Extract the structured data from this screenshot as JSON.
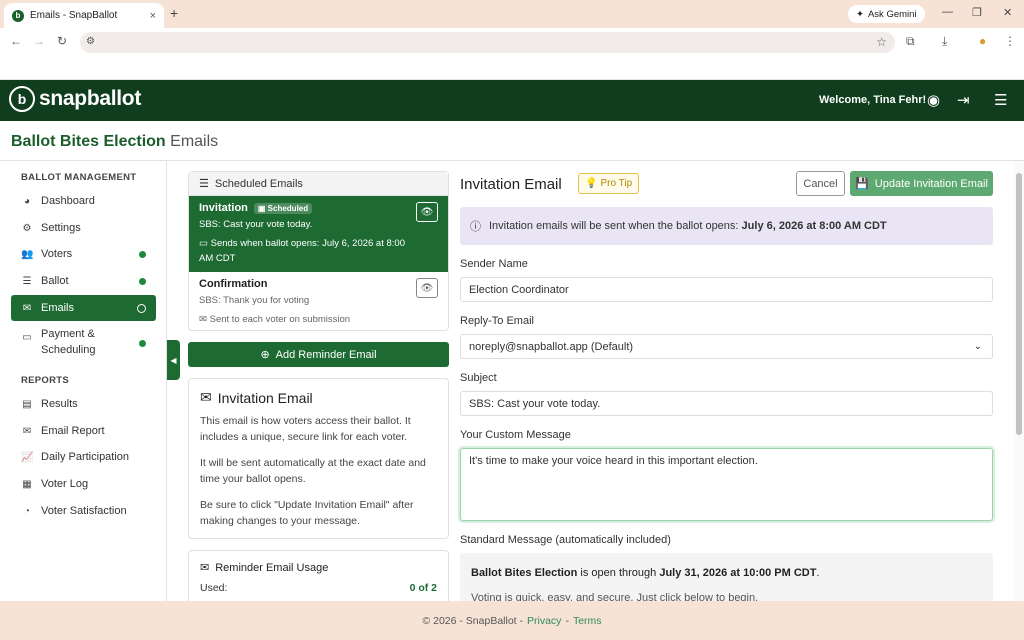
{
  "browser": {
    "tab_title": "Emails - SnapBallot",
    "tab_close": "×",
    "new_tab": "+",
    "ask_gemini": "Ask Gemini"
  },
  "header": {
    "brand": "snapballot",
    "welcome": "Welcome, Tina Fehr!"
  },
  "page": {
    "election": "Ballot Bites Election",
    "section": "Emails"
  },
  "sidebar": {
    "management_heading": "BALLOT MANAGEMENT",
    "reports_heading": "REPORTS",
    "items": [
      {
        "label": "Dashboard"
      },
      {
        "label": "Settings"
      },
      {
        "label": "Voters"
      },
      {
        "label": "Ballot"
      },
      {
        "label": "Emails"
      },
      {
        "label": "Payment &"
      },
      {
        "label": "Scheduling"
      }
    ],
    "reports": [
      {
        "label": "Results"
      },
      {
        "label": "Email Report"
      },
      {
        "label": "Daily Participation"
      },
      {
        "label": "Voter Log"
      },
      {
        "label": "Voter Satisfaction"
      }
    ]
  },
  "scheduled": {
    "heading": "Scheduled Emails",
    "invitation": {
      "name": "Invitation",
      "badge": "Scheduled",
      "subject": "SBS: Cast your vote today.",
      "when_1": "Sends when ballot opens: July 6, 2026 at 8:00",
      "when_2": "AM CDT"
    },
    "confirmation": {
      "name": "Confirmation",
      "subject": "SBS: Thank you for voting",
      "when": "Sent to each voter on submission"
    },
    "add_reminder": "Add Reminder Email"
  },
  "info": {
    "title": "Invitation Email",
    "p1": "This email is how voters access their ballot. It includes a unique, secure link for each voter.",
    "p2": "It will be sent automatically at the exact date and time your ballot opens.",
    "p3": "Be sure to click \"Update Invitation Email\" after making changes to your message."
  },
  "usage": {
    "title": "Reminder Email Usage",
    "used_label": "Used:",
    "used_value": "0 of 2"
  },
  "editor": {
    "title": "Invitation Email",
    "pro_tip": "Pro Tip",
    "cancel": "Cancel",
    "update": "Update Invitation Email",
    "alert_text": "Invitation emails will be sent when the ballot opens:",
    "alert_date": "July 6, 2026 at 8:00 AM CDT",
    "sender_label": "Sender Name",
    "sender_value": "Election Coordinator",
    "reply_label": "Reply-To Email",
    "reply_value": "noreply@snapballot.app (Default)",
    "subject_label": "Subject",
    "subject_value": "SBS: Cast your vote today.",
    "custom_label": "Your Custom Message",
    "custom_value": "It's time to make your voice heard in this important election.",
    "standard_label": "Standard Message (automatically included)",
    "std_election": "Ballot Bites Election",
    "std_mid": "is open through",
    "std_date": "July 31, 2026 at 10:00 PM CDT",
    "std_end": ".",
    "std_line2": "Voting is quick, easy, and secure. Just click below to begin."
  },
  "footer": {
    "copyright": "© 2026 - SnapBallot -",
    "privacy": "Privacy",
    "sep": "-",
    "terms": "Terms"
  }
}
